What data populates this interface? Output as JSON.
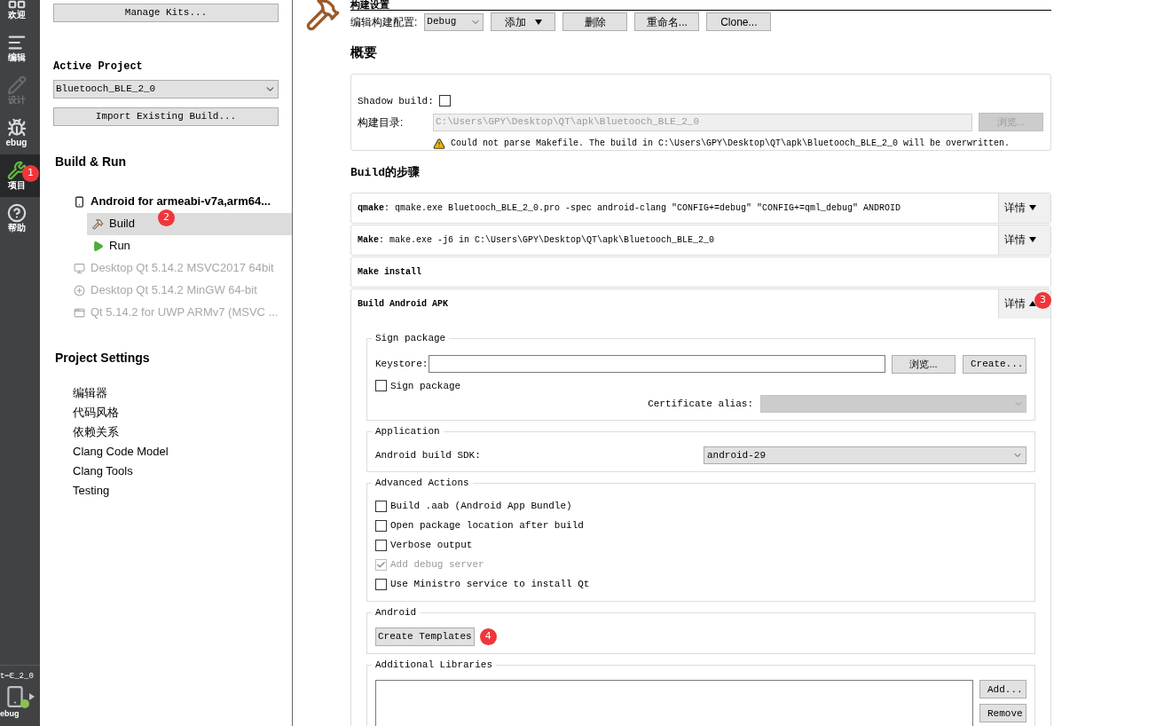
{
  "rail": {
    "items": [
      {
        "label": "欢迎",
        "selected": false,
        "disabled": false
      },
      {
        "label": "编辑",
        "selected": false,
        "disabled": false
      },
      {
        "label": "设计",
        "selected": false,
        "disabled": true
      },
      {
        "label": "ebug",
        "selected": false,
        "disabled": false
      },
      {
        "label": "项目",
        "selected": true,
        "disabled": false,
        "badge": "1"
      },
      {
        "label": "帮助",
        "selected": false,
        "disabled": false
      }
    ],
    "kit": {
      "project": "t⋯E_2_0",
      "mode": "ebug"
    }
  },
  "sidebar": {
    "manage_kits": "Manage Kits...",
    "active_project": {
      "title": "Active Project",
      "value": "Bluetooch_BLE_2_0"
    },
    "import_button": "Import Existing Build...",
    "build_run": {
      "title": "Build & Run",
      "kits": [
        {
          "label": "Android for armeabi-v7a,arm64...",
          "kind": "android",
          "enabled": true,
          "children": [
            {
              "label": "Build",
              "kind": "build",
              "selected": true,
              "badge": "2"
            },
            {
              "label": "Run",
              "kind": "run",
              "selected": false
            }
          ]
        },
        {
          "label": "Desktop Qt 5.14.2 MSVC2017 64bit",
          "kind": "monitor",
          "enabled": false
        },
        {
          "label": "Desktop Qt 5.14.2 MinGW 64-bit",
          "kind": "add",
          "enabled": false
        },
        {
          "label": "Qt 5.14.2 for UWP ARMv7 (MSVC ...",
          "kind": "windows",
          "enabled": false
        }
      ]
    },
    "project_settings": {
      "title": "Project Settings",
      "items": [
        {
          "label": "编辑器",
          "selected": false
        },
        {
          "label": "代码风格",
          "selected": false
        },
        {
          "label": "依赖关系",
          "selected": false
        },
        {
          "label": "Clang Code Model",
          "selected": false
        },
        {
          "label": "Clang Tools",
          "selected": false
        },
        {
          "label": "Testing",
          "selected": false
        }
      ]
    }
  },
  "main": {
    "title": "构建设置",
    "config_label": "编辑构建配置:",
    "config_value": "Debug",
    "buttons": [
      {
        "label": "添加",
        "kind": "menu"
      },
      {
        "label": "删除",
        "kind": "plain"
      },
      {
        "label": "重命名...",
        "kind": "plain"
      },
      {
        "label": "Clone...",
        "kind": "plain"
      }
    ],
    "overview": {
      "title": "概要",
      "shadow_label": "Shadow build:",
      "shadow_checked": false,
      "dir_label": "构建目录:",
      "dir_value": "C:\\Users\\GPY\\Desktop\\QT\\apk\\Bluetooch_BLE_2_0",
      "dir_disabled": true,
      "browse": "浏览...",
      "warning": "Could not parse Makefile. The build in C:\\Users\\GPY\\Desktop\\QT\\apk\\Bluetooch_BLE_2_0 will be overwritten."
    },
    "steps_title": "Build的步骤",
    "steps": [
      {
        "text": "**qmake**: qmake.exe Bluetooch_BLE_2_0.pro -spec android-clang \"CONFIG+=debug\" \"CONFIG+=qml_debug\" ANDROID",
        "details": "详情",
        "expanded": false
      },
      {
        "text": "**Make**: make.exe -j6 in C:\\Users\\GPY\\Desktop\\QT\\apk\\Bluetooch_BLE_2_0",
        "details": "详情",
        "expanded": false
      },
      {
        "text": "Make install"
      },
      {
        "text": "Build Android APK",
        "details": "详情",
        "expanded": true,
        "badge": "3"
      }
    ],
    "apk": {
      "sign": {
        "title": "Sign package",
        "keystore_label": "Keystore:",
        "browse": "浏览...",
        "create": "Create...",
        "checkbox": {
          "label": "Sign package",
          "checked": false
        },
        "alias_label": "Certificate alias:",
        "alias_disabled": true
      },
      "application": {
        "title": "Application",
        "sdk_label": "Android build SDK:",
        "sdk_value": "android-29"
      },
      "advanced": {
        "title": "Advanced Actions",
        "options": [
          {
            "label": "Build .aab (Android App Bundle)",
            "checked": false,
            "disabled": false
          },
          {
            "label": "Open package location after build",
            "checked": false,
            "disabled": false
          },
          {
            "label": "Verbose output",
            "checked": false,
            "disabled": false
          },
          {
            "label": "Add debug server",
            "checked": true,
            "disabled": true
          },
          {
            "label": "Use Ministro service to install Qt",
            "checked": false,
            "disabled": false
          }
        ]
      },
      "android": {
        "title": "Android",
        "button": "Create Templates",
        "badge": "4"
      },
      "libraries": {
        "title": "Additional Libraries",
        "add": "Add...",
        "remove": "Remove"
      }
    }
  }
}
